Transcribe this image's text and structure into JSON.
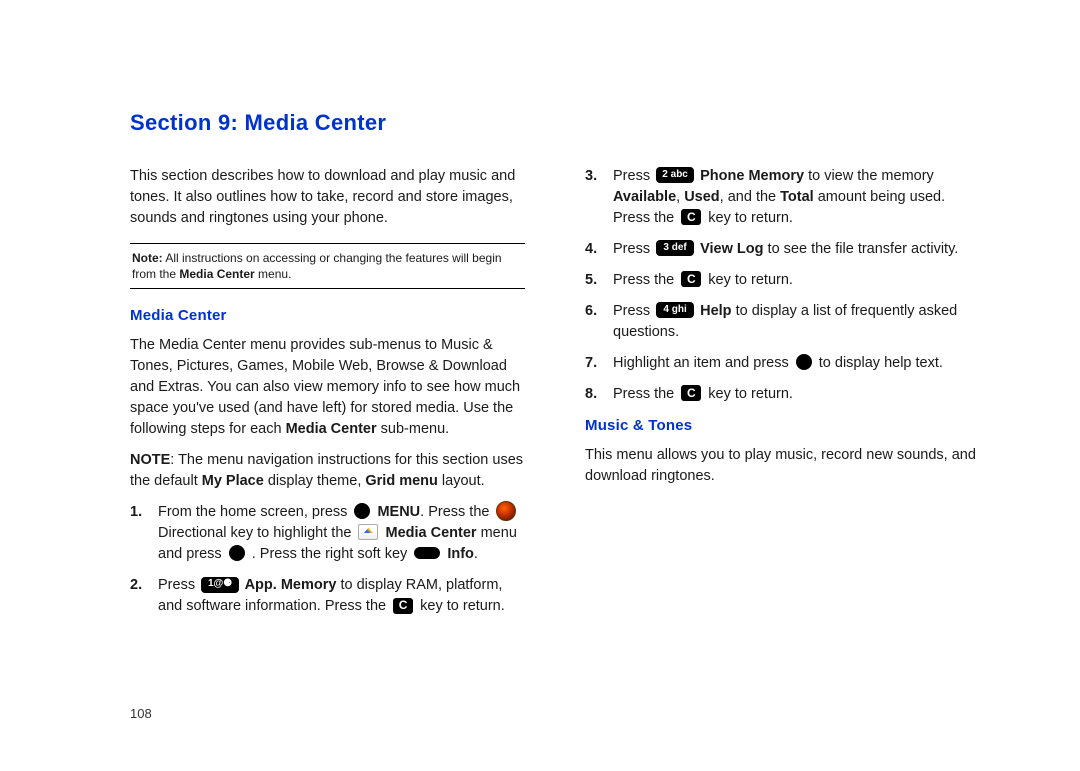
{
  "sectionTitle": "Section 9:  Media Center",
  "pageNumber": "108",
  "left": {
    "intro": "This section describes how to download and play music and tones. It also outlines how to take, record and store images, sounds and ringtones using your phone.",
    "noteLabel": "Note:",
    "noteText": " All instructions on accessing or changing the features will begin from the ",
    "noteBold": "Media Center",
    "noteTail": " menu.",
    "heading": "Media Center",
    "p1a": "The Media Center menu provides sub-menus to Music & Tones, Pictures, Games, Mobile Web, Browse & Download and Extras. You can also view memory info to see how much space you've used (and have left) for stored media. Use the following steps for each ",
    "p1bold": "Media Center",
    "p1b": " sub-menu.",
    "p2a": "NOTE",
    "p2b": ": The menu navigation instructions for this section uses the default ",
    "p2c": "My Place",
    "p2d": " display theme, ",
    "p2e": "Grid menu",
    "p2f": " layout.",
    "s1_a": "From the home screen, press ",
    "s1_menu": " MENU",
    "s1_b": ". Press the ",
    "s1_c": " Directional key to highlight the ",
    "s1_mc": " Media Center",
    "s1_d": " menu and press ",
    "s1_e": " . Press the right soft key ",
    "s1_info": " Info",
    "s1_f": ".",
    "s2_a": "Press ",
    "s2_key": "1@⚈",
    "s2_b": " App. Memory",
    "s2_c": " to display RAM, platform, and software information. Press the ",
    "s2_d": " key to return."
  },
  "right": {
    "s3_a": "Press ",
    "s3_key": "2 abc",
    "s3_b": " Phone Memory",
    "s3_c": " to view the memory ",
    "s3_d": "Available",
    "s3_e": ", ",
    "s3_f": "Used",
    "s3_g": ", and the ",
    "s3_h": "Total",
    "s3_i": " amount being used. Press the ",
    "s3_j": " key to return.",
    "s4_a": "Press ",
    "s4_key": "3 def",
    "s4_b": " View Log",
    "s4_c": " to see the file transfer activity.",
    "s5_a": "Press the ",
    "s5_b": " key to return.",
    "s6_a": "Press ",
    "s6_key": "4 ghi",
    "s6_b": " Help",
    "s6_c": " to display a list of frequently asked questions.",
    "s7_a": "Highlight an item and press ",
    "s7_b": " to display help text.",
    "s8_a": "Press the ",
    "s8_b": " key to return.",
    "heading2": "Music & Tones",
    "p3": "This menu allows you to play music, record new sounds, and download ringtones."
  }
}
